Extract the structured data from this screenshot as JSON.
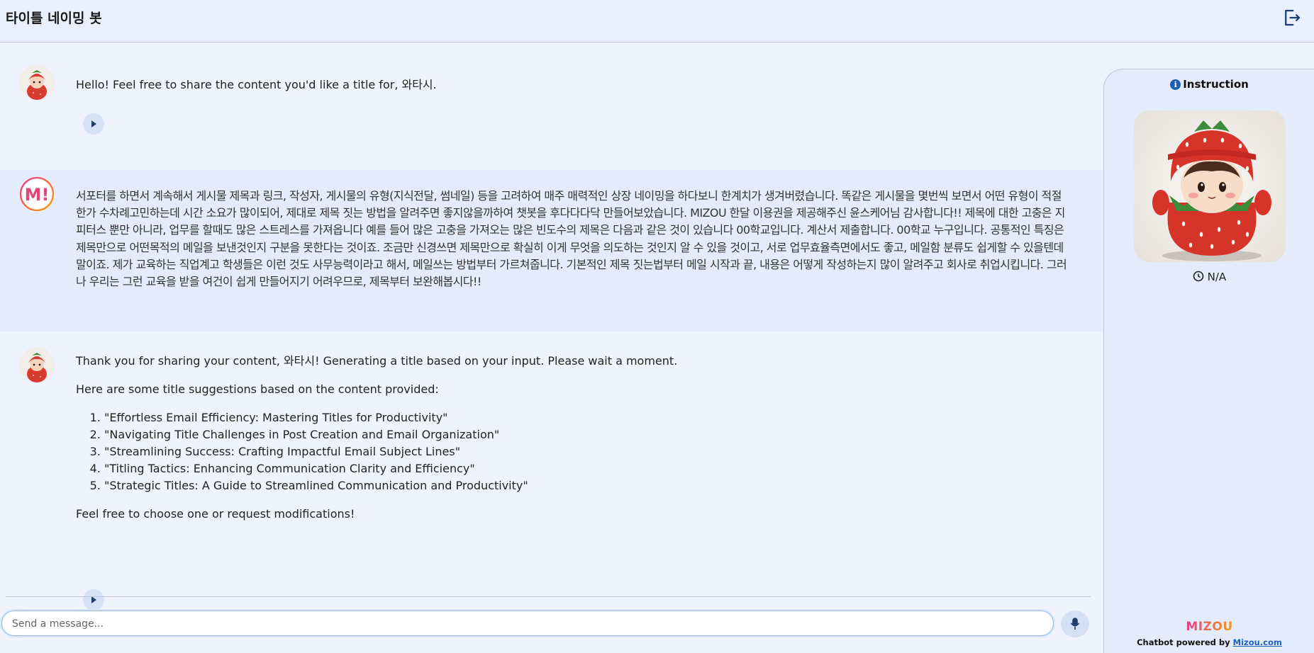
{
  "header": {
    "title": "타이틀 네이밍 봇",
    "logout_icon": "logout-icon"
  },
  "messages": {
    "m1": {
      "text": "Hello! Feel free to share the content you'd like a title for, 와타시."
    },
    "m2": {
      "text": "서포터를 하면서 계속해서 게시물 제목과 링크, 작성자, 게시물의 유형(지식전달, 썸네일) 등을 고려하여 매주 매력적인 상장 네이밍을 하다보니 한계치가 생겨버렸습니다. 똑같은 게시물을 몇번씩 보면서 어떤 유형이 적절한가 수차례고민하는데 시간 소요가 많이되어, 제대로 제목 짓는 방법을 알려주면 좋지않을까하여 챗봇을 후다다다닥 만들어보았습니다. MIZOU 한달 이용권을 제공해주신 윤스케어님 감사합니다!! 제목에 대한 고충은 지피터스 뿐만 아니라, 업무를 할때도 많은 스트레스를 가져옵니다 예를 들어 많은 고충을 가져오는 많은 빈도수의 제목은 다음과 같은 것이 있습니다 00학교입니다. 계산서 제출합니다. 00학교 누구입니다. 공통적인 특징은 제목만으로 어떤목적의 메일을 보낸것인지 구분을 못한다는 것이죠. 조금만 신경쓰면 제목만으로 확실히 이게 무엇을 의도하는 것인지 알 수 있을 것이고, 서로 업무효율측면에서도 좋고, 메일함 분류도 쉽게할 수 있을텐데말이죠. 제가 교육하는 직업계고 학생들은 이런 것도 사무능력이라고 해서, 메일쓰는 방법부터 가르쳐줍니다. 기본적인 제목 짓는법부터 메일 시작과 끝, 내용은 어떻게 작성하는지 많이 알려주고 회사로 취업시킵니다. 그러나 우리는 그런 교육을 받을 여건이 쉽게 만들어지기 어려우므로, 제목부터 보완해봅시다!!"
    },
    "m3": {
      "intro": "Thank you for sharing your content, 와타시! Generating a title based on your input. Please wait a moment.",
      "lead": "Here are some title suggestions based on the content provided:",
      "items": [
        "\"Effortless Email Efficiency: Mastering Titles for Productivity\"",
        "\"Navigating Title Challenges in Post Creation and Email Organization\"",
        "\"Streamlining Success: Crafting Impactful Email Subject Lines\"",
        "\"Titling Tactics: Enhancing Communication Clarity and Efficiency\"",
        "\"Strategic Titles: A Guide to Streamlined Communication and Productivity\""
      ],
      "outro": "Feel free to choose one or request modifications!"
    }
  },
  "composer": {
    "placeholder": "Send a message...",
    "mic_icon": "microphone-icon"
  },
  "sidebar": {
    "instruction_label": "Instruction",
    "timer_value": "N/A",
    "brand": "MIZOU",
    "powered_prefix": "Chatbot powered by ",
    "powered_link": "Mizou.com"
  },
  "colors": {
    "accent": "#1d62c0",
    "background": "#eef3fd",
    "user_bubble": "#e4ebfa",
    "brand_pink": "#e83e8c",
    "brand_orange": "#f59e0b"
  }
}
